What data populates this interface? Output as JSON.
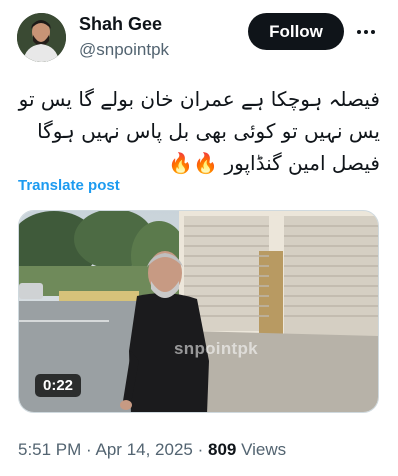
{
  "author": {
    "name": "Shah Gee",
    "handle": "@snpointpk",
    "follow_label": "Follow"
  },
  "tweet": {
    "lines": [
      "فیصلہ ہوچکا ہے عمران خان بولے گا یس تو",
      "یس نہیں تو کوئی بھی بل پاس نہیں ہوگا",
      "فیصل امین گنڈاپور 🔥🔥"
    ],
    "translate_label": "Translate post"
  },
  "media": {
    "duration": "0:22",
    "watermark": "snpointpk"
  },
  "meta": {
    "time": "5:51 PM",
    "sep1": "·",
    "date": "Apr 14, 2025",
    "sep2": "·",
    "views_count": "809",
    "views_label": "Views"
  },
  "icons": {
    "more": "more-dots-icon",
    "play": "video-player"
  },
  "colors": {
    "link": "#1d9bf0",
    "text": "#0f1419",
    "muted": "#536471",
    "follow_bg": "#0f1419"
  }
}
